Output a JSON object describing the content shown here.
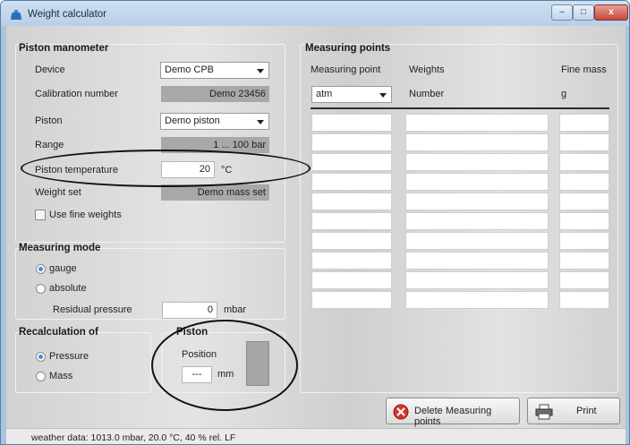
{
  "window": {
    "title": "Weight calculator",
    "min_label": "–",
    "max_label": "□",
    "close_label": "x"
  },
  "piston_manometer": {
    "title": "Piston manometer",
    "device_label": "Device",
    "device_value": "Demo CPB",
    "calibration_label": "Calibration number",
    "calibration_value": "Demo 23456",
    "piston_label": "Piston",
    "piston_value": "Demo piston",
    "range_label": "Range",
    "range_value": "1 ... 100 bar",
    "temperature_label": "Piston temperature",
    "temperature_value": "20",
    "temperature_unit": "°C",
    "weightset_label": "Weight set",
    "weightset_value": "Demo mass set",
    "fine_weights_label": "Use fine weights",
    "fine_weights_checked": false
  },
  "measuring_mode": {
    "title": "Measuring mode",
    "gauge_label": "gauge",
    "absolute_label": "absolute",
    "selected": "gauge",
    "residual_label": "Residual pressure",
    "residual_value": "0",
    "residual_unit": "mbar"
  },
  "recalculation": {
    "title": "Recalculation of",
    "pressure_label": "Pressure",
    "mass_label": "Mass",
    "selected": "Pressure"
  },
  "piston": {
    "title": "Piston",
    "position_label": "Position",
    "position_value": "---",
    "position_unit": "mm"
  },
  "measuring_points": {
    "title": "Measuring points",
    "col_point": "Measuring point",
    "col_weights": "Weights",
    "col_fine": "Fine mass",
    "point_unit": "atm",
    "weights_unit": "Number",
    "fine_unit": "g",
    "row_count": 10
  },
  "buttons": {
    "delete_label": "Delete Measuring points",
    "print_label": "Print"
  },
  "status": {
    "text": "weather data: 1013.0 mbar, 20.0 °C, 40 % rel. LF"
  },
  "colors": {
    "accent": "#3a8fe0",
    "delete_icon": "#d9322a",
    "readonly_bg": "#a8a8a8"
  }
}
